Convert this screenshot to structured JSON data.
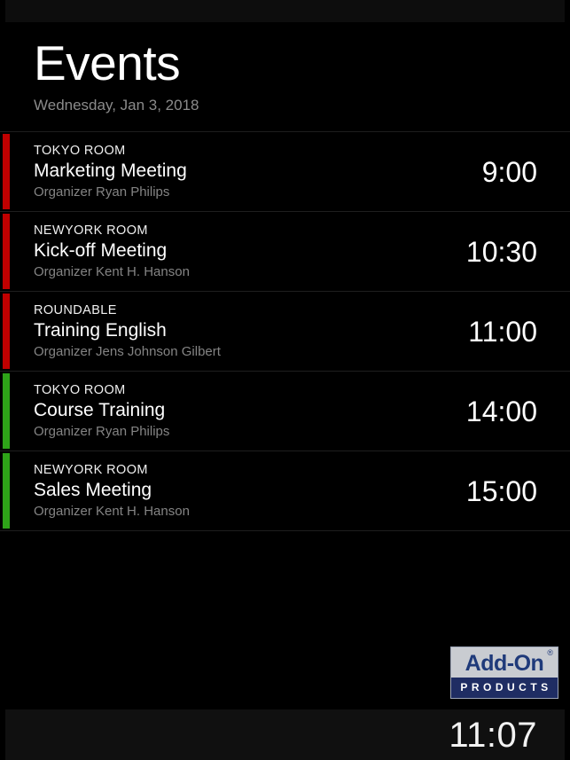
{
  "header": {
    "title": "Events",
    "date": "Wednesday, Jan 3, 2018"
  },
  "colors": {
    "busy": "#c00000",
    "free": "#2ea318",
    "background": "#000000",
    "bar_background": "#101010"
  },
  "events": [
    {
      "room": "TOKYO ROOM",
      "title": "Marketing Meeting",
      "organizer": "Organizer Ryan Philips",
      "time": "9:00",
      "status_color": "#c00000"
    },
    {
      "room": "NEWYORK ROOM",
      "title": "Kick-off Meeting",
      "organizer": "Organizer Kent H. Hanson",
      "time": "10:30",
      "status_color": "#c00000"
    },
    {
      "room": "ROUNDABLE",
      "title": "Training English",
      "organizer": "Organizer Jens Johnson Gilbert",
      "time": "11:00",
      "status_color": "#c00000"
    },
    {
      "room": "TOKYO ROOM",
      "title": "Course Training",
      "organizer": "Organizer Ryan Philips",
      "time": "14:00",
      "status_color": "#2ea318"
    },
    {
      "room": "NEWYORK ROOM",
      "title": "Sales Meeting",
      "organizer": "Organizer Kent H. Hanson",
      "time": "15:00",
      "status_color": "#2ea318"
    }
  ],
  "logo": {
    "wordmark": "Add-On",
    "registered": "®",
    "subtitle": "PRODUCTS"
  },
  "clock": {
    "time": "11:07"
  }
}
